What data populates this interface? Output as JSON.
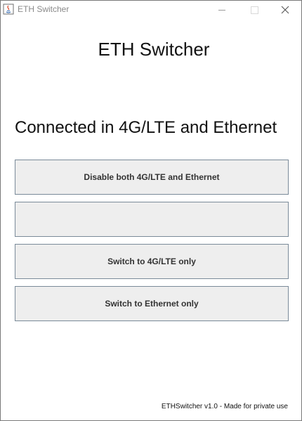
{
  "window": {
    "title": "ETH Switcher",
    "controls": {
      "minimize": "minimize-icon",
      "maximize": "maximize-icon",
      "close": "close-icon"
    }
  },
  "main": {
    "heading": "ETH Switcher",
    "status": "Connected in 4G/LTE and Ethernet",
    "buttons": [
      {
        "label": "Disable both 4G/LTE and Ethernet"
      },
      {
        "label": ""
      },
      {
        "label": "Switch to 4G/LTE only"
      },
      {
        "label": "Switch to Ethernet only"
      }
    ]
  },
  "footer": {
    "text": "ETHSwitcher v1.0 - Made for private use"
  },
  "colors": {
    "button_bg": "#eeeeee",
    "button_border": "#7a8a99",
    "window_bg": "#ffffff"
  }
}
